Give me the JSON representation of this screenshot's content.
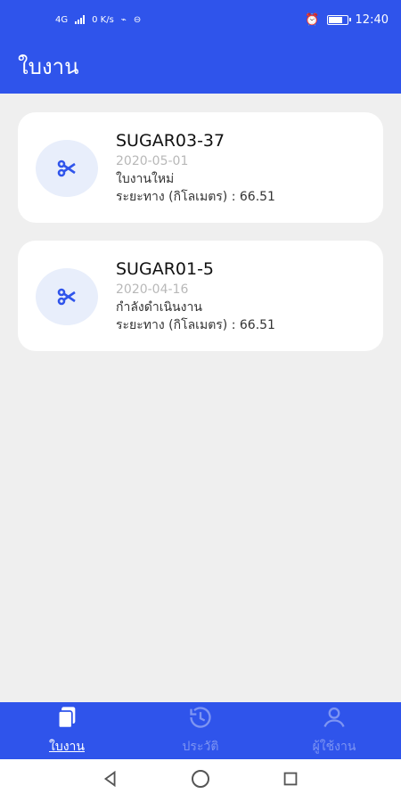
{
  "status_bar": {
    "left_network": "4G",
    "left_speed": "0 K/s",
    "time": "12:40"
  },
  "app_bar": {
    "title": "ใบงาน"
  },
  "jobs": [
    {
      "code": "SUGAR03-37",
      "date": "2020-05-01",
      "status": "ใบงานใหม่",
      "distance": "ระยะทาง (กิโลเมตร) : 66.51",
      "icon": "scissors-icon"
    },
    {
      "code": "SUGAR01-5",
      "date": "2020-04-16",
      "status": "กำลังดำเนินงาน",
      "distance": "ระยะทาง (กิโลเมตร) : 66.51",
      "icon": "scissors-icon"
    }
  ],
  "bottom_nav": {
    "items": [
      {
        "label": "ใบงาน",
        "icon": "document-icon",
        "active": true
      },
      {
        "label": "ประวัติ",
        "icon": "history-icon",
        "active": false
      },
      {
        "label": "ผู้ใช้งาน",
        "icon": "user-icon",
        "active": false
      }
    ]
  },
  "colors": {
    "primary": "#2f54eb",
    "background": "#efefef",
    "card": "#ffffff",
    "icon_circle": "#e8eefb",
    "inactive_nav": "#7e95f2"
  }
}
